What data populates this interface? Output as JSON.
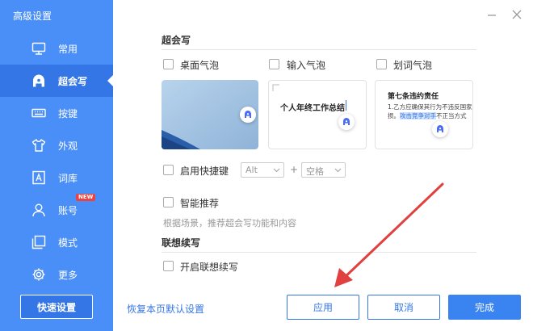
{
  "sidebar": {
    "title": "高级设置",
    "items": [
      {
        "label": "常用",
        "icon": "monitor-icon"
      },
      {
        "label": "超会写",
        "icon": "ai-write-icon",
        "active": true
      },
      {
        "label": "按键",
        "icon": "keyboard-icon"
      },
      {
        "label": "外观",
        "icon": "shirt-icon"
      },
      {
        "label": "词库",
        "icon": "dictionary-icon"
      },
      {
        "label": "账号",
        "icon": "user-icon",
        "badge": "NEW"
      },
      {
        "label": "模式",
        "icon": "mode-icon"
      },
      {
        "label": "更多",
        "icon": "gear-icon"
      }
    ],
    "quick_settings": "快速设置"
  },
  "colors": {
    "sidebar_bg": "#4a8ff7",
    "sidebar_active": "#3576e6",
    "primary": "#3a84f2",
    "badge": "#f04141",
    "arrow": "#e04040"
  },
  "main": {
    "section1": {
      "title": "超会写",
      "options": [
        {
          "label": "桌面气泡",
          "checked": false
        },
        {
          "label": "输入气泡",
          "checked": false
        },
        {
          "label": "划词气泡",
          "checked": false
        }
      ],
      "preview_input": {
        "text": "个人年终工作总结"
      },
      "preview_select": {
        "title": "第七条违约责任",
        "line1": "1.乙方应确保其行为不违反国家",
        "line2_pre": "损。",
        "line2_highlight": "攻击竞争对手",
        "line2_post": "不正当方式"
      },
      "hotkey": {
        "label": "启用快捷键",
        "key1": "Alt",
        "plus": "+",
        "key2": "空格"
      },
      "smart": {
        "label": "智能推荐",
        "hint": "根据场景，推荐超会写功能和内容"
      }
    },
    "section2": {
      "title": "联想续写",
      "option": "开启联想续写"
    }
  },
  "footer": {
    "restore_link": "恢复本页默认设置",
    "apply": "应用",
    "cancel": "取消",
    "done": "完成"
  }
}
